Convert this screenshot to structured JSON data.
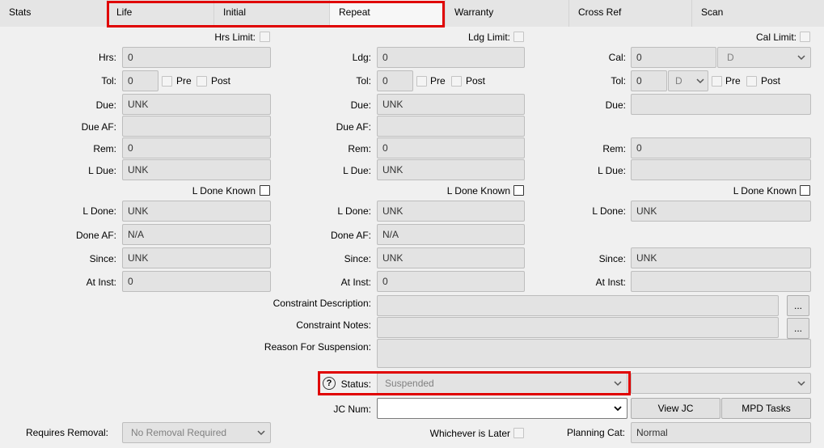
{
  "tabs": [
    "Stats",
    "Life",
    "Initial",
    "Repeat",
    "Warranty",
    "Cross Ref",
    "Scan"
  ],
  "labels": {
    "hrs_limit": "Hrs Limit:",
    "ldg_limit": "Ldg Limit:",
    "cal_limit": "Cal Limit:",
    "hrs": "Hrs:",
    "ldg": "Ldg:",
    "cal": "Cal:",
    "tol": "Tol:",
    "pre": "Pre",
    "post": "Post",
    "due": "Due:",
    "due_af": "Due AF:",
    "rem": "Rem:",
    "l_due": "L Due:",
    "l_done_known": "L Done Known",
    "l_done": "L Done:",
    "done_af": "Done AF:",
    "since": "Since:",
    "at_inst": "At Inst:",
    "constraint_description": "Constraint Description:",
    "constraint_notes": "Constraint Notes:",
    "reason_for_suspension": "Reason For Suspension:",
    "status": "Status:",
    "jc_num": "JC Num:",
    "requires_removal": "Requires Removal:",
    "whichever_is_later": "Whichever is Later",
    "planning_cat": "Planning Cat:"
  },
  "hours": {
    "hrs": "0",
    "tol": "0",
    "due": "UNK",
    "due_af": "",
    "rem": "0",
    "l_due": "UNK",
    "l_done": "UNK",
    "done_af": "N/A",
    "since": "UNK",
    "at_inst": "0"
  },
  "landings": {
    "ldg": "0",
    "tol": "0",
    "due": "UNK",
    "due_af": "",
    "rem": "0",
    "l_due": "UNK",
    "l_done": "UNK",
    "done_af": "N/A",
    "since": "UNK",
    "at_inst": "0"
  },
  "calendar": {
    "cal": "0",
    "cal_unit": "D",
    "tol": "0",
    "tol_unit": "D",
    "due": "",
    "rem": "0",
    "l_due": "",
    "l_done": "UNK",
    "since": "UNK",
    "at_inst": ""
  },
  "ellipsis": "...",
  "status_value": "Suspended",
  "status_help": "?",
  "buttons": {
    "view_jc": "View JC",
    "mpd_tasks": "MPD Tasks"
  },
  "requires_removal_value": "No Removal Required",
  "planning_cat_value": "Normal",
  "highlight_color": "#e00000"
}
